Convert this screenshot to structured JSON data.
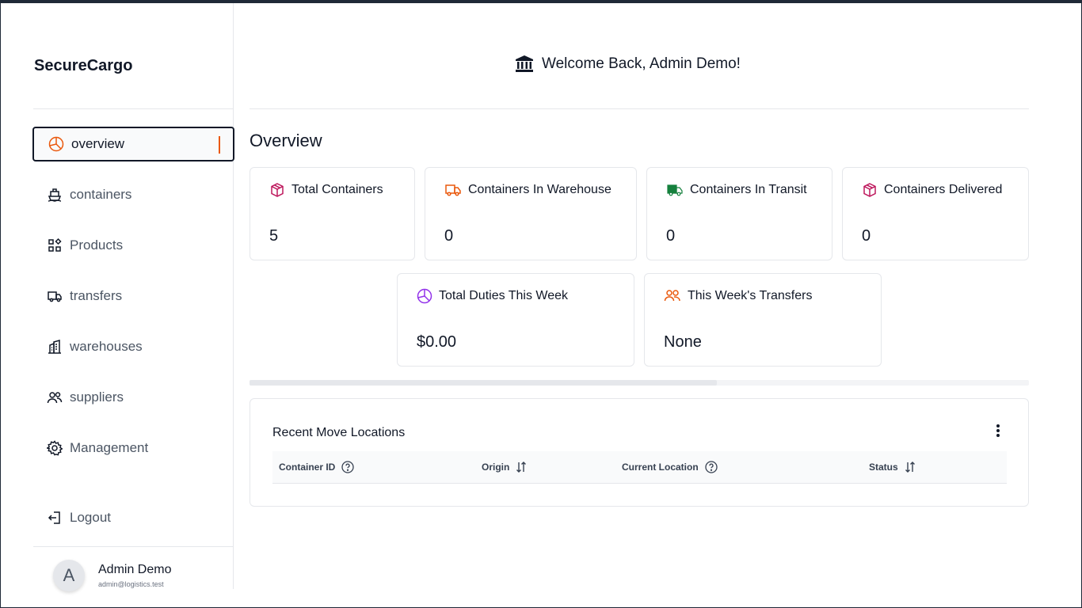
{
  "app": {
    "brand": "SecureCargo"
  },
  "sidebar": {
    "items": [
      {
        "label": "overview"
      },
      {
        "label": "containers"
      },
      {
        "label": "Products"
      },
      {
        "label": "transfers"
      },
      {
        "label": "warehouses"
      },
      {
        "label": "suppliers"
      },
      {
        "label": "Management"
      }
    ],
    "active": "overview",
    "logout_label": "Logout"
  },
  "user": {
    "initial": "A",
    "name": "Admin Demo",
    "email": "admin@logistics.test"
  },
  "header": {
    "welcome": "Welcome Back, Admin Demo!"
  },
  "overview": {
    "title": "Overview",
    "cards": [
      {
        "label": "Total Containers",
        "value": "5",
        "icon": "box-icon",
        "color": "#be185d"
      },
      {
        "label": "Containers In Warehouse",
        "value": "0",
        "icon": "truck-icon",
        "color": "#ea580c"
      },
      {
        "label": "Containers In Transit",
        "value": "0",
        "icon": "truck-icon",
        "color": "#15803d"
      },
      {
        "label": "Containers Delivered",
        "value": "0",
        "icon": "box-icon",
        "color": "#be185d"
      },
      {
        "label": "Total Duties This Week",
        "value": "$0.00",
        "icon": "pie-chart-icon",
        "color": "#9333ea"
      },
      {
        "label": "This Week's Transfers",
        "value": "None",
        "icon": "users-icon",
        "color": "#ea580c"
      }
    ]
  },
  "recent": {
    "title": "Recent Move Locations",
    "columns": [
      {
        "label": "Container ID",
        "icon": "help-icon"
      },
      {
        "label": "Origin",
        "icon": "sort-icon"
      },
      {
        "label": "Current Location",
        "icon": "help-icon"
      },
      {
        "label": "Status",
        "icon": "sort-icon"
      }
    ]
  },
  "colors": {
    "accent": "#ea580c",
    "text": "#111827",
    "muted": "#4b5563",
    "border": "#e5e7eb"
  }
}
